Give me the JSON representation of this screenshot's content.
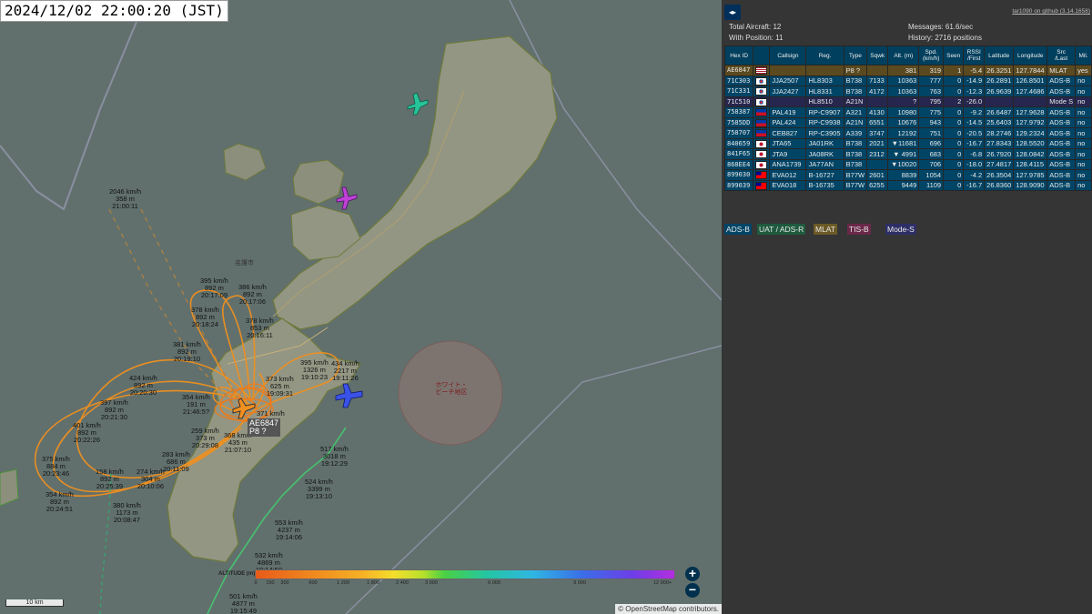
{
  "timestamp": "2024/12/02 22:00:20 (JST)",
  "panel": {
    "toggle_label": "◂▸",
    "github_link": "tar1090 on github (3.14.1658)",
    "total_aircraft_label": "Total Aircraft:",
    "total_aircraft": "12",
    "with_position_label": "With Position:",
    "with_position": "11",
    "messages_label": "Messages:",
    "messages": "61.6/sec",
    "history_label": "History:",
    "history": "2716 positions"
  },
  "table": {
    "headers": [
      "Hex ID",
      "",
      "Callsign",
      "Reg.",
      "Type",
      "Sqwk",
      "Alt. (m)",
      "Spd. (km/h)",
      "Seen",
      "RSSI /First",
      "Latitude",
      "Longitude",
      "Src /Last",
      "Mil."
    ],
    "rows": [
      {
        "hex": "AE6847",
        "flag": "us",
        "callsign": "",
        "reg": "",
        "type": "P8 ?",
        "sqwk": "",
        "alt": "381",
        "spd": "319",
        "seen": "1",
        "rssi": "-5.4",
        "lat": "26.3251",
        "lon": "127.7844",
        "src": "MLAT",
        "mil": "yes",
        "kind": "mlat"
      },
      {
        "hex": "71C303",
        "flag": "kr",
        "callsign": "JJA2507",
        "reg": "HL8303",
        "type": "B738",
        "sqwk": "7133",
        "alt": "10363",
        "spd": "777",
        "seen": "0",
        "rssi": "-14.9",
        "lat": "26.2891",
        "lon": "126.8501",
        "src": "ADS-B",
        "mil": "no",
        "kind": "adsb"
      },
      {
        "hex": "71C331",
        "flag": "kr",
        "callsign": "JJA2427",
        "reg": "HL8331",
        "type": "B738",
        "sqwk": "4172",
        "alt": "10363",
        "spd": "763",
        "seen": "0",
        "rssi": "-12.3",
        "lat": "26.9639",
        "lon": "127.4686",
        "src": "ADS-B",
        "mil": "no",
        "kind": "adsb"
      },
      {
        "hex": "71C510",
        "flag": "kr",
        "callsign": "",
        "reg": "HL8510",
        "type": "A21N",
        "sqwk": "",
        "alt": "?",
        "spd": "795",
        "seen": "2",
        "rssi": "-26.0",
        "lat": "",
        "lon": "",
        "src": "Mode S",
        "mil": "no",
        "kind": "modes"
      },
      {
        "hex": "758387",
        "flag": "ph",
        "callsign": "PAL419",
        "reg": "RP-C9907",
        "type": "A321",
        "sqwk": "4130",
        "alt": "10980",
        "spd": "775",
        "seen": "0",
        "rssi": "-9.2",
        "lat": "26.6487",
        "lon": "127.9628",
        "src": "ADS-B",
        "mil": "no",
        "kind": "adsb"
      },
      {
        "hex": "7585DD",
        "flag": "ph",
        "callsign": "PAL424",
        "reg": "RP-C9938",
        "type": "A21N",
        "sqwk": "6551",
        "alt": "10676",
        "spd": "943",
        "seen": "0",
        "rssi": "-14.5",
        "lat": "25.6403",
        "lon": "127.9792",
        "src": "ADS-B",
        "mil": "no",
        "kind": "adsb"
      },
      {
        "hex": "758707",
        "flag": "ph",
        "callsign": "CEB827",
        "reg": "RP-C3905",
        "type": "A339",
        "sqwk": "3747",
        "alt": "12192",
        "spd": "751",
        "seen": "0",
        "rssi": "-20.5",
        "lat": "28.2746",
        "lon": "129.2324",
        "src": "ADS-B",
        "mil": "no",
        "kind": "adsb"
      },
      {
        "hex": "840659",
        "flag": "jp",
        "callsign": "JTA65",
        "reg": "JA01RK",
        "type": "B738",
        "sqwk": "2021",
        "alt": "▼11681",
        "spd": "696",
        "seen": "0",
        "rssi": "-16.7",
        "lat": "27.8343",
        "lon": "128.5520",
        "src": "ADS-B",
        "mil": "no",
        "kind": "adsb"
      },
      {
        "hex": "841F65",
        "flag": "jp",
        "callsign": "JTA9",
        "reg": "JA08RK",
        "type": "B738",
        "sqwk": "2312",
        "alt": "▼ 4991",
        "spd": "683",
        "seen": "0",
        "rssi": "-6.8",
        "lat": "26.7920",
        "lon": "128.0842",
        "src": "ADS-B",
        "mil": "no",
        "kind": "adsb"
      },
      {
        "hex": "868EE4",
        "flag": "jp",
        "callsign": "ANA1739",
        "reg": "JA77AN",
        "type": "B738",
        "sqwk": "",
        "alt": "▼10020",
        "spd": "706",
        "seen": "0",
        "rssi": "-18.0",
        "lat": "27.4817",
        "lon": "128.4115",
        "src": "ADS-B",
        "mil": "no",
        "kind": "adsb"
      },
      {
        "hex": "899030",
        "flag": "tw",
        "callsign": "EVA012",
        "reg": "B-16727",
        "type": "B77W",
        "sqwk": "2601",
        "alt": "8839",
        "spd": "1054",
        "seen": "0",
        "rssi": "-4.2",
        "lat": "26.3504",
        "lon": "127.9785",
        "src": "ADS-B",
        "mil": "no",
        "kind": "adsb"
      },
      {
        "hex": "899039",
        "flag": "tw",
        "callsign": "EVA018",
        "reg": "B-16735",
        "type": "B77W",
        "sqwk": "6255",
        "alt": "9449",
        "spd": "1109",
        "seen": "0",
        "rssi": "-16.7",
        "lat": "26.8360",
        "lon": "128.9090",
        "src": "ADS-B",
        "mil": "no",
        "kind": "adsb"
      }
    ]
  },
  "source_legend": [
    {
      "label": "ADS-B",
      "bg": "#004466",
      "fg": "#e8e8e8"
    },
    {
      "label": "UAT / ADS-R",
      "bg": "#1f5a3e",
      "fg": "#e8e8e8"
    },
    {
      "label": "MLAT",
      "bg": "#6b5a26",
      "fg": "#e8e8e8"
    },
    {
      "label": "TIS-B",
      "bg": "#6a2848",
      "fg": "#e8e8e8"
    },
    {
      "label": "Mode-S",
      "bg": "#2e2e66",
      "fg": "#e8e8e8"
    }
  ],
  "map": {
    "selected_label_hex": "AE6847",
    "selected_label_type": "P8 ?",
    "scale_label": "10 km",
    "osm_attribution": "© OpenStreetMap contributors.",
    "altitude_title": "ALTITUDE (m)",
    "altitude_ticks": [
      "0",
      "150",
      "300",
      "600",
      "1 200",
      "1 800",
      "2 400",
      "3 000",
      "6 000",
      "9 000",
      "12 000+"
    ],
    "zoom_in": "+",
    "zoom_out": "−",
    "place_labels": [
      "名護市",
      "ホワイト・ビーチ地区"
    ],
    "track_labels": [
      {
        "text": "2046 km/h\n358 m\n21:00:11"
      },
      {
        "text": "395 km/h\n892 m\n20:17:09"
      },
      {
        "text": "386 km/h\n892 m\n20:17:06"
      },
      {
        "text": "378 km/h\n892 m\n20:18:24"
      },
      {
        "text": "378 km/h\n853 m\n20:16:11"
      },
      {
        "text": "381 km/h\n892 m\n20:19:10"
      },
      {
        "text": "395 km/h\n1326 m\n19:10:23"
      },
      {
        "text": "434 km/h\n2217 m\n19:11:26"
      },
      {
        "text": "424 km/h\n892 m\n20:20:30"
      },
      {
        "text": "373 km/h\n625 m\n19:09:31"
      },
      {
        "text": "354 km/h\n191 m\n21:46:5?"
      },
      {
        "text": "397 km/h\n892 m\n20:21:30"
      },
      {
        "text": "401 km/h\n892 m\n20:22:26"
      },
      {
        "text": "371 km/h\n373 m"
      },
      {
        "text": "259 km/h\n373 m\n20:29:08"
      },
      {
        "text": "368 km/h\n435 m\n21:07:10"
      },
      {
        "text": "517 km/h\n3018 m\n19:12:29"
      },
      {
        "text": "283 km/h\n686 m\n20:11:09"
      },
      {
        "text": "375 km/h\n884 m\n20:23:46"
      },
      {
        "text": "158 km/h\n892 m\n20:25:39"
      },
      {
        "text": "274 km/h\n304 m\n20:10:06"
      },
      {
        "text": "524 km/h\n3399 m\n19:13:10"
      },
      {
        "text": "354 km/h\n892 m\n20:24:51"
      },
      {
        "text": "380 km/h\n1173 m\n20:08:47"
      },
      {
        "text": "553 km/h\n4237 m\n19:14:06"
      },
      {
        "text": "532 km/h\n4869 m\n19:14:50"
      },
      {
        "text": "501 km/h\n4877 m\n19:15:49"
      }
    ]
  }
}
